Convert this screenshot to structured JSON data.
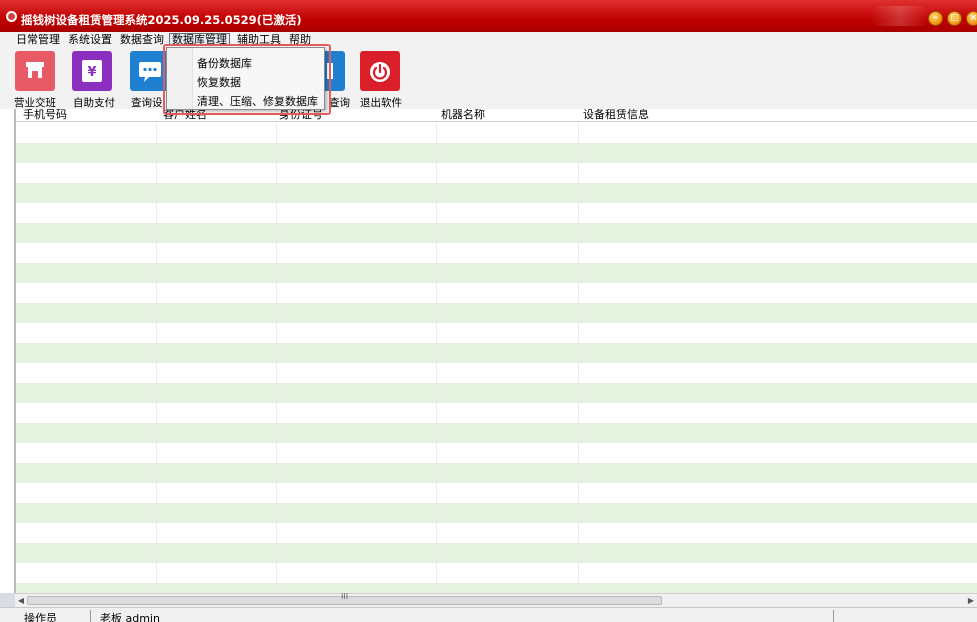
{
  "window": {
    "title": "摇钱树设备租赁管理系统2025.09.25.0529(已激活)",
    "controls": {
      "minimize": "–",
      "maximize": "□",
      "close": "×"
    }
  },
  "menubar": {
    "items": [
      "日常管理",
      "系统设置",
      "数据查询",
      "数据库管理",
      "辅助工具",
      "帮助"
    ],
    "active": "数据库管理"
  },
  "toolbar": {
    "buttons": [
      {
        "label": "营业交班",
        "icon": "store-icon",
        "color": "#e85b66"
      },
      {
        "label": "自助支付",
        "icon": "yen-icon",
        "color": "#8a2fc0"
      },
      {
        "label": "查询设备",
        "icon": "chat-icon",
        "color": "#1f7fd1"
      },
      {
        "label": "查询",
        "icon": "search-icon",
        "color": "#1f7fd1"
      },
      {
        "label": "退出软件",
        "icon": "power-icon",
        "color": "#d81f2a"
      }
    ],
    "visible_labels": [
      "营业交班",
      "自助支付",
      "查询设",
      "查询",
      "退出软件"
    ]
  },
  "grid": {
    "columns": [
      "手机号码",
      "客户姓名",
      "身份证号",
      "机器名称",
      "设备租赁信息"
    ],
    "row_count": 24,
    "row_colors": {
      "even": "#ffffff",
      "odd": "#e6f2e0"
    }
  },
  "dropdown": {
    "items": [
      "备份数据库",
      "恢复数据",
      "清理、压缩、修复数据库"
    ]
  },
  "scrollbar": {
    "grip": "III"
  },
  "statusbar": {
    "label": "操作员",
    "value": "老板 admin"
  }
}
